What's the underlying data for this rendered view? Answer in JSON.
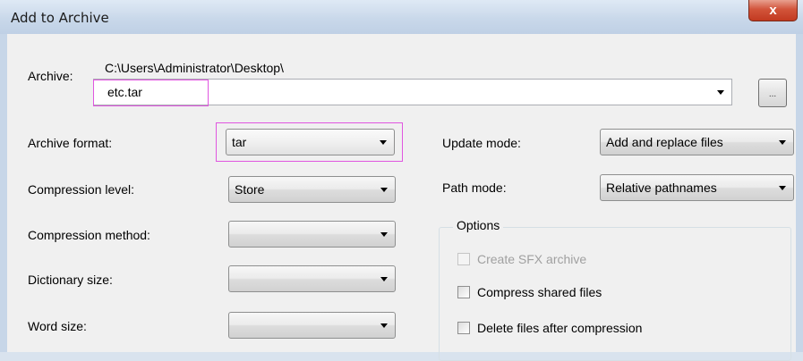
{
  "window": {
    "title": "Add to Archive",
    "close_glyph": "x"
  },
  "archive": {
    "label": "Archive:",
    "path": "C:\\Users\\Administrator\\Desktop\\",
    "value": "etc.tar",
    "browse_label": "..."
  },
  "left": {
    "archive_format": {
      "label": "Archive format:",
      "value": "tar"
    },
    "compression_level": {
      "label": "Compression level:",
      "value": "Store"
    },
    "compression_method": {
      "label": "Compression method:",
      "value": ""
    },
    "dictionary_size": {
      "label": "Dictionary size:",
      "value": ""
    },
    "word_size": {
      "label": "Word size:",
      "value": ""
    }
  },
  "right": {
    "update_mode": {
      "label": "Update mode:",
      "value": "Add and replace files"
    },
    "path_mode": {
      "label": "Path mode:",
      "value": "Relative pathnames"
    }
  },
  "options": {
    "title": "Options",
    "create_sfx": {
      "label": "Create SFX archive",
      "checked": false,
      "enabled": false
    },
    "compress_shared": {
      "label": "Compress shared files",
      "checked": false,
      "enabled": true
    },
    "delete_after": {
      "label": "Delete files after compression",
      "checked": false,
      "enabled": true
    }
  },
  "colors": {
    "highlight": "#e056e0",
    "close_button": "#c23a20",
    "dialog_bg": "#f0f0f0"
  }
}
